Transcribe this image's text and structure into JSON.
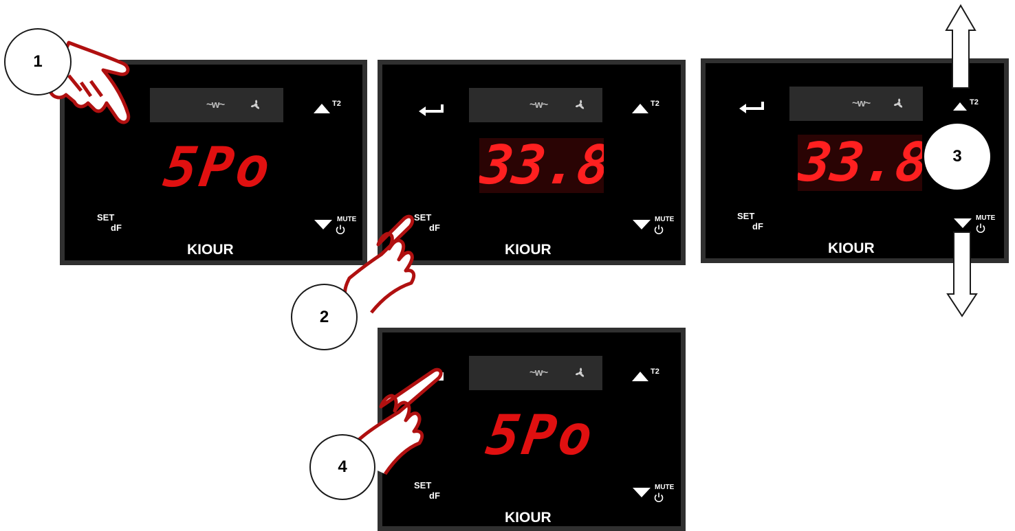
{
  "panels": [
    {
      "display": "5Po",
      "set_label": "SET",
      "df_label": "dF",
      "up_label": "T2",
      "down_label": "MUTE",
      "brand": "KIOUR",
      "step": "1"
    },
    {
      "display": "33.8",
      "set_label": "SET",
      "df_label": "dF",
      "up_label": "T2",
      "down_label": "MUTE",
      "brand": "KIOUR",
      "step": "2"
    },
    {
      "display": "33.8",
      "set_label": "SET",
      "df_label": "dF",
      "up_label": "T2",
      "down_label": "MUTE",
      "brand": "KIOUR",
      "step": "3"
    },
    {
      "display": "5Po",
      "set_label": "SET",
      "df_label": "dF",
      "up_label": "T2",
      "down_label": "MUTE",
      "brand": "KIOUR",
      "step": "4"
    }
  ],
  "colors": {
    "panel_bg": "#000000",
    "panel_border": "#303030",
    "led_red": "#e01010",
    "hand_outline": "#b01010"
  },
  "icons": [
    "hand-pointer-icon",
    "enter-arrow-icon",
    "heater-icon",
    "fan-icon",
    "up-triangle-icon",
    "down-triangle-icon",
    "power-icon",
    "outline-arrow-up-icon",
    "outline-arrow-down-icon"
  ]
}
